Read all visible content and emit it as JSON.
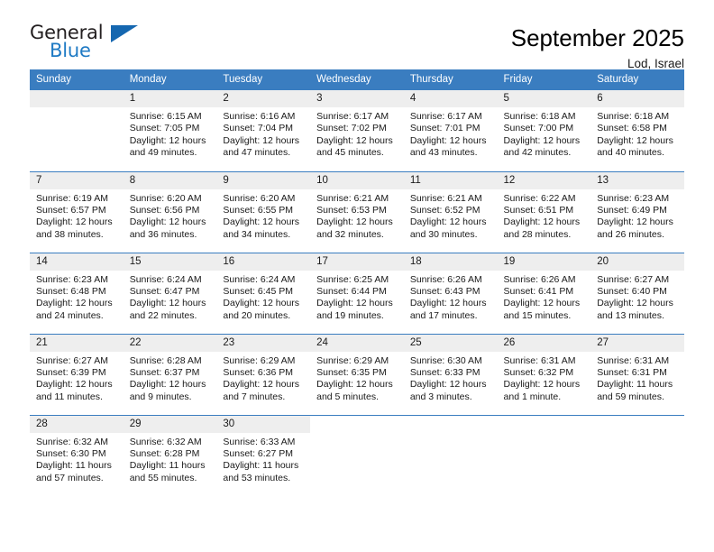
{
  "brand": {
    "name_part1": "General",
    "name_part2": "Blue",
    "triangle_color": "#1567b0",
    "blue_color": "#1f7ac4"
  },
  "header": {
    "title": "September 2025",
    "subtitle": "Lod, Israel"
  },
  "theme": {
    "header_bg": "#3a7dc0",
    "daynum_bg": "#eeeeee",
    "rule_color": "#3a7dc0",
    "text_color": "#1a1a1a"
  },
  "labels": {
    "sunrise_prefix": "Sunrise:",
    "sunset_prefix": "Sunset:",
    "daylight_prefix": "Daylight:"
  },
  "weekdays": [
    "Sunday",
    "Monday",
    "Tuesday",
    "Wednesday",
    "Thursday",
    "Friday",
    "Saturday"
  ],
  "weeks": [
    [
      {
        "day": "",
        "empty": true
      },
      {
        "day": "1",
        "sunrise": "Sunrise: 6:15 AM",
        "sunset": "Sunset: 7:05 PM",
        "daylight_line1": "Daylight: 12 hours",
        "daylight_line2": "and 49 minutes."
      },
      {
        "day": "2",
        "sunrise": "Sunrise: 6:16 AM",
        "sunset": "Sunset: 7:04 PM",
        "daylight_line1": "Daylight: 12 hours",
        "daylight_line2": "and 47 minutes."
      },
      {
        "day": "3",
        "sunrise": "Sunrise: 6:17 AM",
        "sunset": "Sunset: 7:02 PM",
        "daylight_line1": "Daylight: 12 hours",
        "daylight_line2": "and 45 minutes."
      },
      {
        "day": "4",
        "sunrise": "Sunrise: 6:17 AM",
        "sunset": "Sunset: 7:01 PM",
        "daylight_line1": "Daylight: 12 hours",
        "daylight_line2": "and 43 minutes."
      },
      {
        "day": "5",
        "sunrise": "Sunrise: 6:18 AM",
        "sunset": "Sunset: 7:00 PM",
        "daylight_line1": "Daylight: 12 hours",
        "daylight_line2": "and 42 minutes."
      },
      {
        "day": "6",
        "sunrise": "Sunrise: 6:18 AM",
        "sunset": "Sunset: 6:58 PM",
        "daylight_line1": "Daylight: 12 hours",
        "daylight_line2": "and 40 minutes."
      }
    ],
    [
      {
        "day": "7",
        "sunrise": "Sunrise: 6:19 AM",
        "sunset": "Sunset: 6:57 PM",
        "daylight_line1": "Daylight: 12 hours",
        "daylight_line2": "and 38 minutes."
      },
      {
        "day": "8",
        "sunrise": "Sunrise: 6:20 AM",
        "sunset": "Sunset: 6:56 PM",
        "daylight_line1": "Daylight: 12 hours",
        "daylight_line2": "and 36 minutes."
      },
      {
        "day": "9",
        "sunrise": "Sunrise: 6:20 AM",
        "sunset": "Sunset: 6:55 PM",
        "daylight_line1": "Daylight: 12 hours",
        "daylight_line2": "and 34 minutes."
      },
      {
        "day": "10",
        "sunrise": "Sunrise: 6:21 AM",
        "sunset": "Sunset: 6:53 PM",
        "daylight_line1": "Daylight: 12 hours",
        "daylight_line2": "and 32 minutes."
      },
      {
        "day": "11",
        "sunrise": "Sunrise: 6:21 AM",
        "sunset": "Sunset: 6:52 PM",
        "daylight_line1": "Daylight: 12 hours",
        "daylight_line2": "and 30 minutes."
      },
      {
        "day": "12",
        "sunrise": "Sunrise: 6:22 AM",
        "sunset": "Sunset: 6:51 PM",
        "daylight_line1": "Daylight: 12 hours",
        "daylight_line2": "and 28 minutes."
      },
      {
        "day": "13",
        "sunrise": "Sunrise: 6:23 AM",
        "sunset": "Sunset: 6:49 PM",
        "daylight_line1": "Daylight: 12 hours",
        "daylight_line2": "and 26 minutes."
      }
    ],
    [
      {
        "day": "14",
        "sunrise": "Sunrise: 6:23 AM",
        "sunset": "Sunset: 6:48 PM",
        "daylight_line1": "Daylight: 12 hours",
        "daylight_line2": "and 24 minutes."
      },
      {
        "day": "15",
        "sunrise": "Sunrise: 6:24 AM",
        "sunset": "Sunset: 6:47 PM",
        "daylight_line1": "Daylight: 12 hours",
        "daylight_line2": "and 22 minutes."
      },
      {
        "day": "16",
        "sunrise": "Sunrise: 6:24 AM",
        "sunset": "Sunset: 6:45 PM",
        "daylight_line1": "Daylight: 12 hours",
        "daylight_line2": "and 20 minutes."
      },
      {
        "day": "17",
        "sunrise": "Sunrise: 6:25 AM",
        "sunset": "Sunset: 6:44 PM",
        "daylight_line1": "Daylight: 12 hours",
        "daylight_line2": "and 19 minutes."
      },
      {
        "day": "18",
        "sunrise": "Sunrise: 6:26 AM",
        "sunset": "Sunset: 6:43 PM",
        "daylight_line1": "Daylight: 12 hours",
        "daylight_line2": "and 17 minutes."
      },
      {
        "day": "19",
        "sunrise": "Sunrise: 6:26 AM",
        "sunset": "Sunset: 6:41 PM",
        "daylight_line1": "Daylight: 12 hours",
        "daylight_line2": "and 15 minutes."
      },
      {
        "day": "20",
        "sunrise": "Sunrise: 6:27 AM",
        "sunset": "Sunset: 6:40 PM",
        "daylight_line1": "Daylight: 12 hours",
        "daylight_line2": "and 13 minutes."
      }
    ],
    [
      {
        "day": "21",
        "sunrise": "Sunrise: 6:27 AM",
        "sunset": "Sunset: 6:39 PM",
        "daylight_line1": "Daylight: 12 hours",
        "daylight_line2": "and 11 minutes."
      },
      {
        "day": "22",
        "sunrise": "Sunrise: 6:28 AM",
        "sunset": "Sunset: 6:37 PM",
        "daylight_line1": "Daylight: 12 hours",
        "daylight_line2": "and 9 minutes."
      },
      {
        "day": "23",
        "sunrise": "Sunrise: 6:29 AM",
        "sunset": "Sunset: 6:36 PM",
        "daylight_line1": "Daylight: 12 hours",
        "daylight_line2": "and 7 minutes."
      },
      {
        "day": "24",
        "sunrise": "Sunrise: 6:29 AM",
        "sunset": "Sunset: 6:35 PM",
        "daylight_line1": "Daylight: 12 hours",
        "daylight_line2": "and 5 minutes."
      },
      {
        "day": "25",
        "sunrise": "Sunrise: 6:30 AM",
        "sunset": "Sunset: 6:33 PM",
        "daylight_line1": "Daylight: 12 hours",
        "daylight_line2": "and 3 minutes."
      },
      {
        "day": "26",
        "sunrise": "Sunrise: 6:31 AM",
        "sunset": "Sunset: 6:32 PM",
        "daylight_line1": "Daylight: 12 hours",
        "daylight_line2": "and 1 minute."
      },
      {
        "day": "27",
        "sunrise": "Sunrise: 6:31 AM",
        "sunset": "Sunset: 6:31 PM",
        "daylight_line1": "Daylight: 11 hours",
        "daylight_line2": "and 59 minutes."
      }
    ],
    [
      {
        "day": "28",
        "sunrise": "Sunrise: 6:32 AM",
        "sunset": "Sunset: 6:30 PM",
        "daylight_line1": "Daylight: 11 hours",
        "daylight_line2": "and 57 minutes."
      },
      {
        "day": "29",
        "sunrise": "Sunrise: 6:32 AM",
        "sunset": "Sunset: 6:28 PM",
        "daylight_line1": "Daylight: 11 hours",
        "daylight_line2": "and 55 minutes."
      },
      {
        "day": "30",
        "sunrise": "Sunrise: 6:33 AM",
        "sunset": "Sunset: 6:27 PM",
        "daylight_line1": "Daylight: 11 hours",
        "daylight_line2": "and 53 minutes."
      },
      {
        "day": "",
        "blank": true
      },
      {
        "day": "",
        "blank": true
      },
      {
        "day": "",
        "blank": true
      },
      {
        "day": "",
        "blank": true
      }
    ]
  ]
}
